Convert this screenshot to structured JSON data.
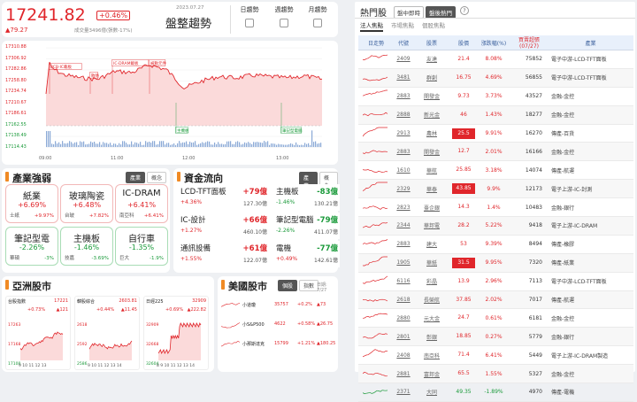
{
  "index": {
    "value": "17241.82",
    "change_pct": "+0.46%",
    "change": "▲79.27",
    "date": "2023.07.27",
    "volume": "成交量3496億(張數-17%)",
    "title": "盤整趨勢"
  },
  "trend_buttons": [
    "日趨勢",
    "週趨勢",
    "月趨勢"
  ],
  "main_chart": {
    "y_ticks": [
      "17310.88",
      "17306.92",
      "17282.86",
      "17258.80",
      "17234.74",
      "17210.67",
      "17186.61",
      "17162.55",
      "17138.49",
      "17114.43"
    ],
    "x_ticks": [
      "09:00",
      "11:00",
      "12:00",
      "13:00"
    ],
    "annotations": [
      "PCB-IC載板",
      "散熱",
      "IC-DRAM載板",
      "被動元件",
      "主機板",
      "筆記型電腦"
    ]
  },
  "industry": {
    "title": "產業強弱",
    "btn_on": "產業",
    "btn_off": "概念",
    "items": [
      {
        "name": "紙業",
        "pct": "+6.69%",
        "sub": "士紙",
        "sub_pct": "+9.97%",
        "dir": "up"
      },
      {
        "name": "玻璃陶瓷",
        "pct": "+6.48%",
        "sub": "台玻",
        "sub_pct": "+7.82%",
        "dir": "up"
      },
      {
        "name": "IC-DRAM",
        "pct": "+6.41%",
        "sub": "南亞科",
        "sub_pct": "+6.41%",
        "dir": "up"
      },
      {
        "name": "筆記型電",
        "pct": "-2.26%",
        "sub": "華碩",
        "sub_pct": "-3%",
        "dir": "down"
      },
      {
        "name": "主機板",
        "pct": "-1.46%",
        "sub": "技嘉",
        "sub_pct": "-3.69%",
        "dir": "down"
      },
      {
        "name": "自行車",
        "pct": "-1.35%",
        "sub": "巨大",
        "sub_pct": "-1.9%",
        "dir": "down"
      }
    ]
  },
  "fund": {
    "title": "資金流向",
    "btn_on": "產業",
    "btn_off": "概念",
    "items": [
      {
        "name": "LCD-TFT面板",
        "val": "+79億",
        "pct": "+4.36%",
        "size": "127.30億",
        "dir": "up"
      },
      {
        "name": "主機板",
        "val": "-83億",
        "pct": "-1.46%",
        "size": "130.21億",
        "dir": "down"
      },
      {
        "name": "IC-設計",
        "val": "+66億",
        "pct": "+1.27%",
        "size": "460.10億",
        "dir": "up"
      },
      {
        "name": "筆記型電腦",
        "val": "-79億",
        "pct": "-2.26%",
        "size": "411.07億",
        "dir": "down"
      },
      {
        "name": "通訊設備",
        "val": "+61億",
        "pct": "+1.55%",
        "size": "122.07億",
        "dir": "up"
      },
      {
        "name": "電機",
        "val": "-77億",
        "pct": "+0.49%",
        "size": "142.61億",
        "dir": "down"
      }
    ]
  },
  "asia": {
    "title": "亞洲股市",
    "items": [
      {
        "name": "台股指數",
        "value": "17221",
        "pct": "+0.73%",
        "chg": "▲121",
        "ticks": [
          "17263",
          "17168",
          "17100"
        ],
        "x": "9 10 11 12 13"
      },
      {
        "name": "韓股綜合",
        "value": "2603.81",
        "pct": "+0.44%",
        "chg": "▲11.45",
        "ticks": [
          "2618",
          "2592",
          "2586"
        ],
        "x": "9 10 11 12 13 14"
      },
      {
        "name": "日經225",
        "value": "32909",
        "pct": "+0.69%",
        "chg": "▲222.82",
        "ticks": [
          "32909",
          "32668",
          "32604"
        ],
        "x": "8 9 10 11 12 13 14"
      }
    ]
  },
  "us": {
    "title": "美國股市",
    "btn_on": "個股",
    "btn_off": "指數",
    "date": "日期: 7/27",
    "items": [
      {
        "name": "小道瓊",
        "value": "35757",
        "pct": "+0.2%",
        "chg": "▲73"
      },
      {
        "name": "小S&P500",
        "value": "4622",
        "pct": "+0.58%",
        "chg": "▲26.75"
      },
      {
        "name": "小那斯達克",
        "value": "15799",
        "pct": "+1.21%",
        "chg": "▲180.25"
      }
    ]
  },
  "hot": {
    "title": "熱門股",
    "tabs": [
      "盤中即時",
      "盤後熱門"
    ],
    "help": "?",
    "subtabs": [
      "法人焦點",
      "市場焦點",
      "個股焦點"
    ],
    "columns": [
      "日走勢",
      "代號",
      "股票",
      "股價",
      "漲跌幅(%)",
      "買賣超張(07/27)",
      "產業"
    ],
    "rows": [
      {
        "code": "2409",
        "name": "友達",
        "price": "21.4",
        "pct": "8.08%",
        "vol": "75852",
        "ind": "電子中游-LCD-TFT面板",
        "box": false,
        "dir": "up"
      },
      {
        "code": "3481",
        "name": "群創",
        "price": "16.75",
        "pct": "4.69%",
        "vol": "56855",
        "ind": "電子中游-LCD-TFT面板",
        "box": false,
        "dir": "up"
      },
      {
        "code": "2883",
        "name": "開發金",
        "price": "9.73",
        "pct": "3.73%",
        "vol": "43527",
        "ind": "金融-金控",
        "box": false,
        "dir": "up"
      },
      {
        "code": "2888",
        "name": "新光金",
        "price": "46",
        "pct": "1.43%",
        "vol": "18277",
        "ind": "金融-金控",
        "box": false,
        "dir": "up"
      },
      {
        "code": "2913",
        "name": "農林",
        "price": "25.5",
        "pct": "9.91%",
        "vol": "16270",
        "ind": "傳產-百貨",
        "box": true,
        "dir": "up"
      },
      {
        "code": "2883",
        "name": "開發金",
        "price": "12.7",
        "pct": "2.01%",
        "vol": "16166",
        "ind": "金融-金控",
        "box": false,
        "dir": "up"
      },
      {
        "code": "1610",
        "name": "華航",
        "price": "25.85",
        "pct": "3.18%",
        "vol": "14074",
        "ind": "傳產-航運",
        "box": false,
        "dir": "up"
      },
      {
        "code": "2329",
        "name": "華泰",
        "price": "43.85",
        "pct": "9.9%",
        "vol": "12173",
        "ind": "電子上游-IC-封測",
        "box": true,
        "dir": "up"
      },
      {
        "code": "2823",
        "name": "臺企銀",
        "price": "14.3",
        "pct": "1.4%",
        "vol": "10483",
        "ind": "金融-銀行",
        "box": false,
        "dir": "up"
      },
      {
        "code": "2344",
        "name": "華邦電",
        "price": "28.2",
        "pct": "5.22%",
        "vol": "9418",
        "ind": "電子上游-IC-DRAM",
        "box": false,
        "dir": "up"
      },
      {
        "code": "2883",
        "name": "建大",
        "price": "53",
        "pct": "9.39%",
        "vol": "8494",
        "ind": "傳產-橡膠",
        "box": false,
        "dir": "up"
      },
      {
        "code": "1905",
        "name": "華紙",
        "price": "31.5",
        "pct": "9.95%",
        "vol": "7320",
        "ind": "傳產-紙業",
        "box": true,
        "dir": "up"
      },
      {
        "code": "6116",
        "name": "彩晶",
        "price": "13.9",
        "pct": "2.96%",
        "vol": "7113",
        "ind": "電子中游-LCD-TFT面板",
        "box": false,
        "dir": "up"
      },
      {
        "code": "2618",
        "name": "長榮航",
        "price": "37.85",
        "pct": "2.02%",
        "vol": "7017",
        "ind": "傳產-航運",
        "box": false,
        "dir": "up"
      },
      {
        "code": "2880",
        "name": "元大金",
        "price": "24.7",
        "pct": "0.61%",
        "vol": "6181",
        "ind": "金融-金控",
        "box": false,
        "dir": "up"
      },
      {
        "code": "2801",
        "name": "彰銀",
        "price": "18.85",
        "pct": "0.27%",
        "vol": "5779",
        "ind": "金融-銀行",
        "box": false,
        "dir": "up"
      },
      {
        "code": "2408",
        "name": "南亞科",
        "price": "71.4",
        "pct": "6.41%",
        "vol": "5449",
        "ind": "電子上游-IC-DRAM製造",
        "box": false,
        "dir": "up"
      },
      {
        "code": "2881",
        "name": "富邦金",
        "price": "65.5",
        "pct": "1.55%",
        "vol": "5327",
        "ind": "金融-金控",
        "box": false,
        "dir": "up"
      },
      {
        "code": "2371",
        "name": "大同",
        "price": "49.35",
        "pct": "-1.89%",
        "vol": "4970",
        "ind": "傳產-電機",
        "box": false,
        "dir": "down"
      }
    ]
  }
}
